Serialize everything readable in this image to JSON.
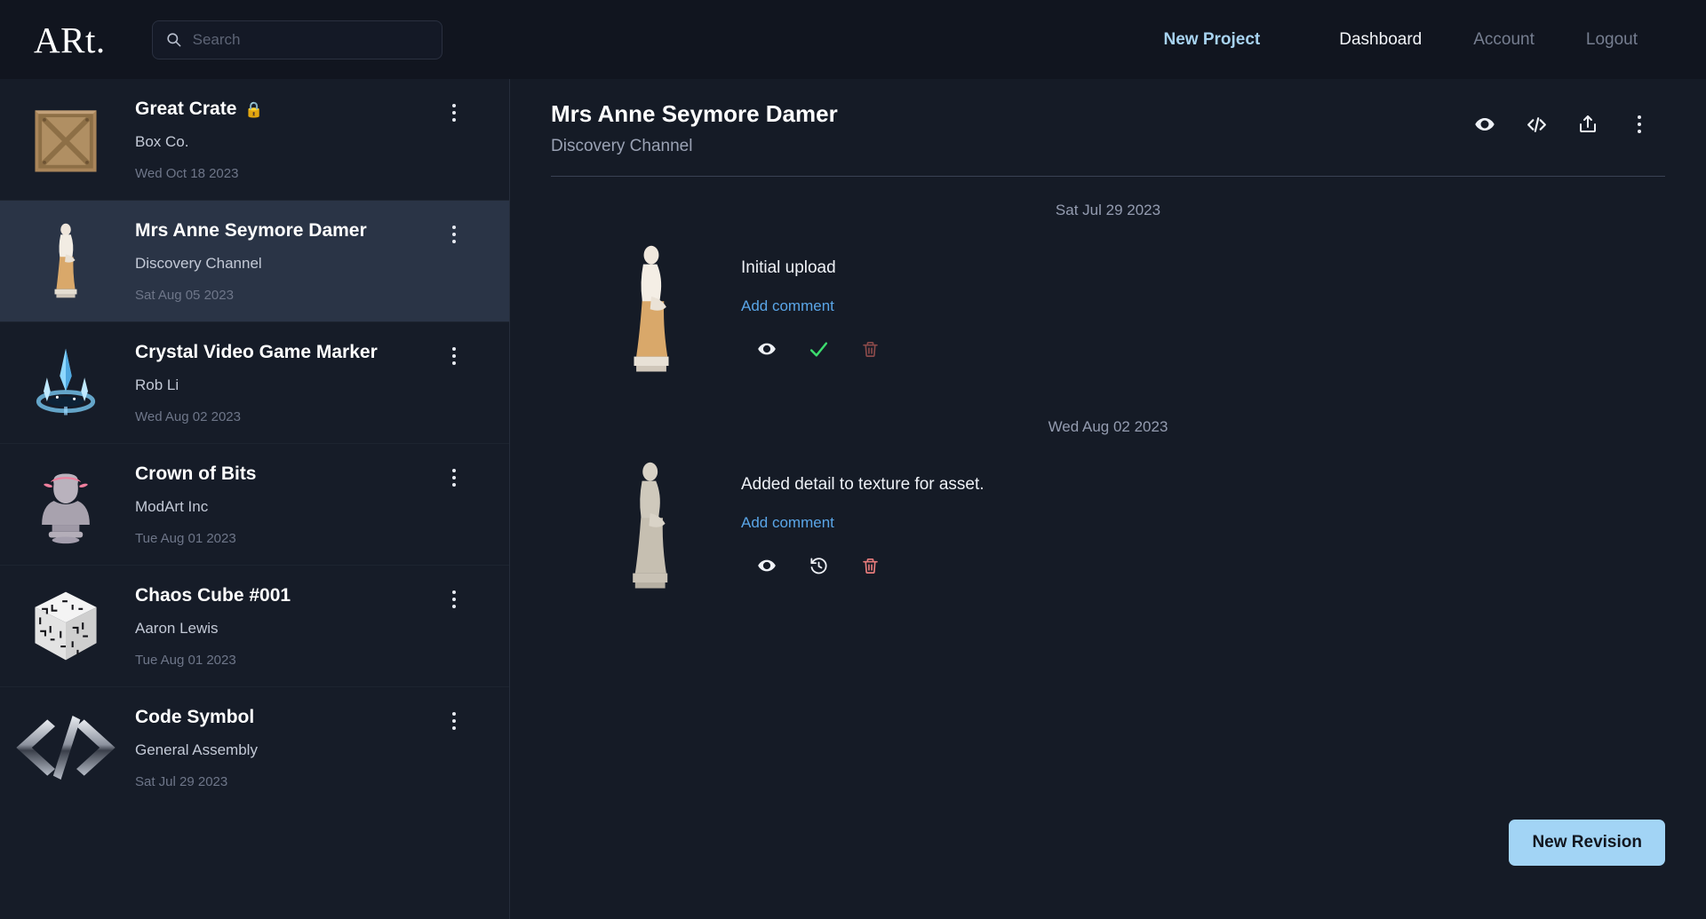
{
  "brand": {
    "logo": "ARt."
  },
  "search": {
    "placeholder": "Search",
    "value": "",
    "icon": "search-icon"
  },
  "nav": {
    "new_project": "New Project",
    "dashboard": "Dashboard",
    "account": "Account",
    "logout": "Logout"
  },
  "colors": {
    "accent": "#a8d3f0",
    "link": "#5aa6e8",
    "approve_green": "#3ddc6e",
    "delete_red": "#e87c7c",
    "delete_red_muted": "#8a4a4a",
    "selected_row": "#2a3446",
    "page_bg": "#151b26",
    "topbar_bg": "#11151f",
    "button_bg": "#a2d4f5"
  },
  "sidebar": {
    "projects": [
      {
        "title": "Great Crate",
        "locked": true,
        "lock_icon": "lock-icon",
        "client": "Box Co.",
        "date": "Wed Oct 18 2023",
        "thumb": "wooden-crate-thumbnail",
        "selected": false
      },
      {
        "title": "Mrs Anne Seymore Damer",
        "locked": false,
        "lock_icon": "",
        "client": "Discovery Channel",
        "date": "Sat Aug 05 2023",
        "thumb": "statue-thumbnail",
        "selected": true
      },
      {
        "title": "Crystal Video Game Marker",
        "locked": false,
        "lock_icon": "",
        "client": "Rob Li",
        "date": "Wed Aug 02 2023",
        "thumb": "crystal-marker-thumbnail",
        "selected": false
      },
      {
        "title": "Crown of Bits",
        "locked": false,
        "lock_icon": "",
        "client": "ModArt Inc",
        "date": "Tue Aug 01 2023",
        "thumb": "bust-thumbnail",
        "selected": false
      },
      {
        "title": "Chaos Cube #001",
        "locked": false,
        "lock_icon": "",
        "client": "Aaron Lewis",
        "date": "Tue Aug 01 2023",
        "thumb": "glyph-cube-thumbnail",
        "selected": false
      },
      {
        "title": "Code Symbol",
        "locked": false,
        "lock_icon": "",
        "client": "General Assembly",
        "date": "Sat Jul 29 2023",
        "thumb": "code-symbol-thumbnail",
        "selected": false
      }
    ]
  },
  "project_detail": {
    "title": "Mrs Anne Seymore Damer",
    "client": "Discovery Channel",
    "header_actions": [
      {
        "name": "preview-icon",
        "label": "Preview"
      },
      {
        "name": "embed-code-icon",
        "label": "Embed"
      },
      {
        "name": "share-icon",
        "label": "Share"
      },
      {
        "name": "more-options-icon",
        "label": "More"
      }
    ],
    "revisions": [
      {
        "date": "Sat Jul 29 2023",
        "message": "Initial upload",
        "comment_label": "Add comment",
        "thumb": "statue-revision-1",
        "actions": [
          {
            "name": "preview-icon",
            "label": "Preview",
            "style": "white"
          },
          {
            "name": "approve-check-icon",
            "label": "Approve",
            "style": "green"
          },
          {
            "name": "delete-trash-icon",
            "label": "Delete",
            "style": "muted-red"
          }
        ]
      },
      {
        "date": "Wed Aug 02 2023",
        "message": "Added detail to texture for asset.",
        "comment_label": "Add comment",
        "thumb": "statue-revision-2",
        "actions": [
          {
            "name": "preview-icon",
            "label": "Preview",
            "style": "white"
          },
          {
            "name": "restore-history-icon",
            "label": "Restore",
            "style": "white"
          },
          {
            "name": "delete-trash-icon",
            "label": "Delete",
            "style": "red"
          }
        ]
      }
    ],
    "new_revision_label": "New Revision"
  }
}
